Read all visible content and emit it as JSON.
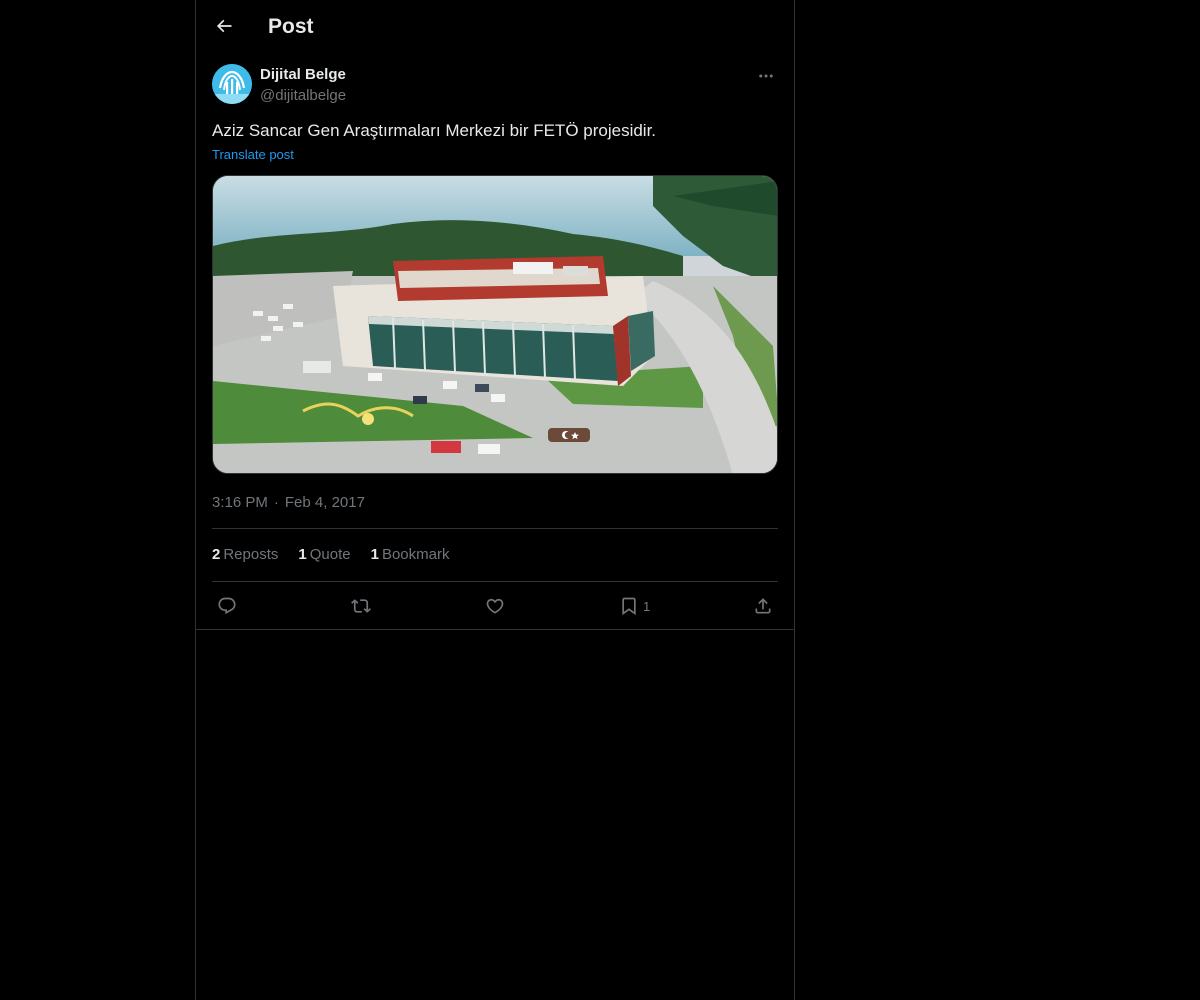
{
  "header": {
    "title": "Post",
    "back_icon": "arrow-left-icon"
  },
  "post": {
    "author": {
      "name": "Dijital Belge",
      "handle": "@dijitalbelge"
    },
    "more_icon": "more-horizontal-icon",
    "text": "Aziz Sancar Gen Araştırmaları Merkezi bir FETÖ projesidir.",
    "translate_label": "Translate post",
    "time": "3:16 PM",
    "separator": "·",
    "date": "Feb 4, 2017",
    "stats": {
      "reposts_count": "2",
      "reposts_label": "Reposts",
      "quotes_count": "1",
      "quotes_label": "Quote",
      "bookmarks_count": "1",
      "bookmarks_label": "Bookmark"
    },
    "actions": {
      "reply_icon": "reply-icon",
      "repost_icon": "repost-icon",
      "like_icon": "heart-icon",
      "bookmark_icon": "bookmark-icon",
      "bookmark_count": "1",
      "share_icon": "share-icon"
    }
  },
  "colors": {
    "background": "#000000",
    "text_primary": "#e7e9ea",
    "text_secondary": "#71767b",
    "accent": "#1d9bf0",
    "border": "#2f3336"
  }
}
